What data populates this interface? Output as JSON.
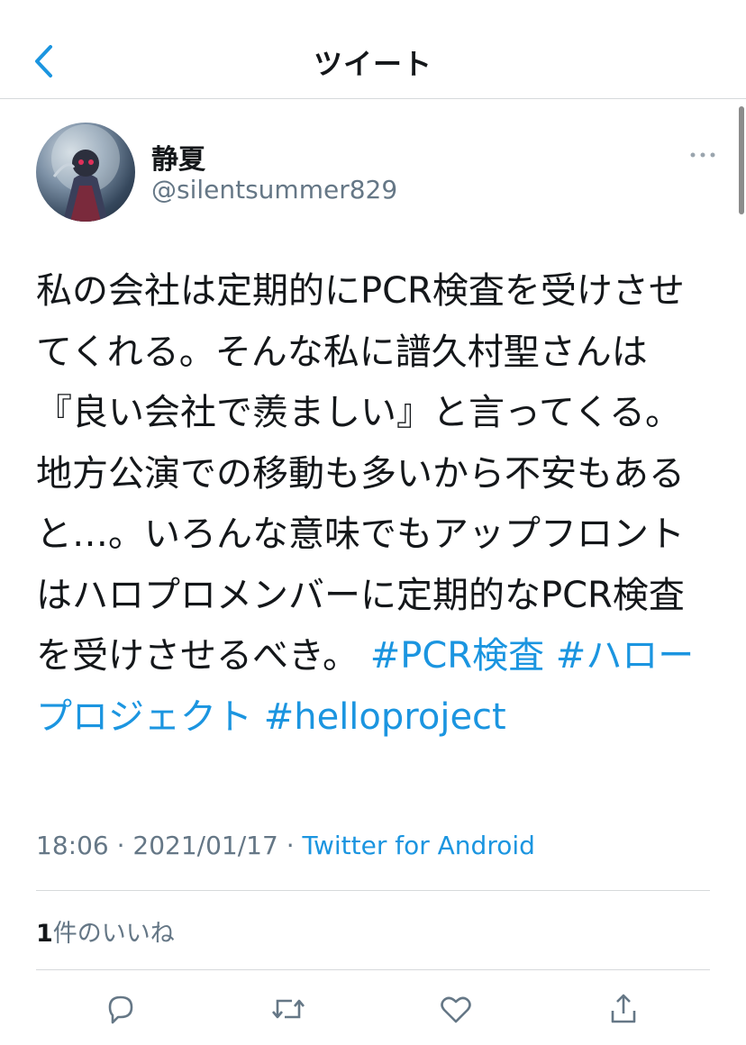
{
  "header": {
    "title": "ツイート"
  },
  "author": {
    "display_name": "静夏",
    "handle": "@silentsummer829"
  },
  "tweet": {
    "text": "私の会社は定期的にPCR検査を受けさせてくれる。そんな私に譜久村聖さんは『良い会社で羨ましい』と言ってくる。地方公演での移動も多いから不安もあると…。いろんな意味でもアップフロントはハロプロメンバーに定期的なPCR検査を受けさせるべき。",
    "hashtags": [
      "#PCR検査",
      "#ハロープロジェクト",
      "#helloproject"
    ],
    "time": "18:06",
    "date": "2021/01/17",
    "source": "Twitter for Android",
    "separator": " · "
  },
  "likes": {
    "count": "1",
    "label": "件のいいね"
  },
  "actions": {
    "reply_icon": "reply-icon",
    "retweet_icon": "retweet-icon",
    "like_icon": "heart-icon",
    "share_icon": "share-icon"
  },
  "colors": {
    "accent": "#1b95e0",
    "secondary_text": "#657786",
    "divider": "#d6d9db"
  }
}
